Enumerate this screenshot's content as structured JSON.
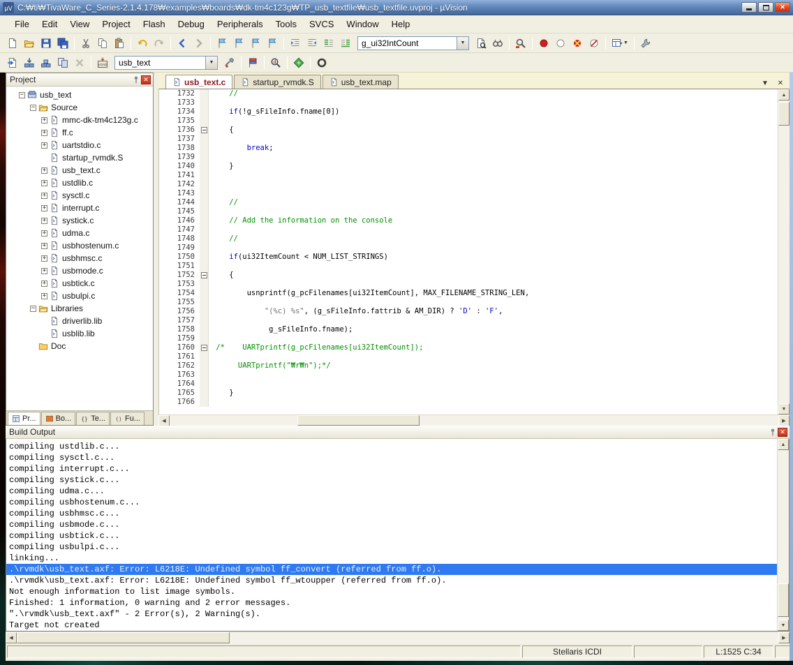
{
  "window": {
    "title": "C:₩ti₩TivaWare_C_Series-2.1.4.178₩examples₩boards₩dk-tm4c123g₩TP_usb_textfile₩usb_textfile.uvproj - µVision"
  },
  "menu": {
    "items": [
      "File",
      "Edit",
      "View",
      "Project",
      "Flash",
      "Debug",
      "Peripherals",
      "Tools",
      "SVCS",
      "Window",
      "Help"
    ]
  },
  "toolbar1": {
    "groups_left": [
      [
        "new-file",
        "open-file",
        "save",
        "save-all"
      ],
      [
        "cut",
        "copy",
        "paste"
      ],
      [
        "undo",
        "redo"
      ],
      [
        "nav-back",
        "nav-forward"
      ],
      [
        "bookmark-toggle",
        "bookmark-prev",
        "bookmark-next",
        "bookmark-clear-all"
      ],
      [
        "indent-right",
        "indent-left",
        "comment-selection",
        "uncomment-selection"
      ]
    ],
    "search_value": "g_ui32IntCount",
    "groups_right": [
      [
        "find-in-files",
        "find-in-files-next"
      ],
      [
        "find"
      ],
      [
        "breakpoint-toggle",
        "breakpoint-disable",
        "breakpoint-kill-all",
        "breakpoint-disable-all"
      ],
      [
        "window-layout"
      ],
      [
        "configure"
      ]
    ]
  },
  "toolbar2": {
    "groups_left": [
      [
        "translate-file",
        "build-target",
        "rebuild-all",
        "batch-build",
        "stop-build"
      ],
      [
        "download-flash"
      ]
    ],
    "target_value": "usb_text",
    "groups_right": [
      [
        "options-for-target"
      ],
      [
        "file-extensions"
      ],
      [
        "debug-session"
      ],
      [
        "rte-manage"
      ],
      [
        "pack-installer"
      ]
    ]
  },
  "project_panel": {
    "title": "Project",
    "tree": [
      {
        "label": "usb_text",
        "level": 0,
        "icon": "target",
        "expander": "minus"
      },
      {
        "label": "Source",
        "level": 1,
        "icon": "folder-open",
        "expander": "minus"
      },
      {
        "label": "mmc-dk-tm4c123g.c",
        "level": 2,
        "icon": "file",
        "expander": "plus"
      },
      {
        "label": "ff.c",
        "level": 2,
        "icon": "file",
        "expander": "plus"
      },
      {
        "label": "uartstdio.c",
        "level": 2,
        "icon": "file",
        "expander": "plus"
      },
      {
        "label": "startup_rvmdk.S",
        "level": 2,
        "icon": "file",
        "expander": "none"
      },
      {
        "label": "usb_text.c",
        "level": 2,
        "icon": "file",
        "expander": "plus"
      },
      {
        "label": "ustdlib.c",
        "level": 2,
        "icon": "file",
        "expander": "plus"
      },
      {
        "label": "sysctl.c",
        "level": 2,
        "icon": "file",
        "expander": "plus"
      },
      {
        "label": "interrupt.c",
        "level": 2,
        "icon": "file",
        "expander": "plus"
      },
      {
        "label": "systick.c",
        "level": 2,
        "icon": "file",
        "expander": "plus"
      },
      {
        "label": "udma.c",
        "level": 2,
        "icon": "file",
        "expander": "plus"
      },
      {
        "label": "usbhostenum.c",
        "level": 2,
        "icon": "file",
        "expander": "plus"
      },
      {
        "label": "usbhmsc.c",
        "level": 2,
        "icon": "file",
        "expander": "plus"
      },
      {
        "label": "usbmode.c",
        "level": 2,
        "icon": "file",
        "expander": "plus"
      },
      {
        "label": "usbtick.c",
        "level": 2,
        "icon": "file",
        "expander": "plus"
      },
      {
        "label": "usbulpi.c",
        "level": 2,
        "icon": "file",
        "expander": "plus"
      },
      {
        "label": "Libraries",
        "level": 1,
        "icon": "folder-open",
        "expander": "minus"
      },
      {
        "label": "driverlib.lib",
        "level": 2,
        "icon": "file",
        "expander": "none"
      },
      {
        "label": "usblib.lib",
        "level": 2,
        "icon": "file",
        "expander": "none"
      },
      {
        "label": "Doc",
        "level": 1,
        "icon": "folder",
        "expander": "none"
      }
    ],
    "tabs": [
      {
        "label": "Pr...",
        "icon": "project-tab"
      },
      {
        "label": "Bo...",
        "icon": "books-tab"
      },
      {
        "label": "Te...",
        "icon": "templates-tab"
      },
      {
        "label": "Fu...",
        "icon": "functions-tab"
      }
    ]
  },
  "editor": {
    "tabs": [
      {
        "label": "usb_text.c",
        "active": true
      },
      {
        "label": "startup_rvmdk.S",
        "active": false
      },
      {
        "label": "usb_text.map",
        "active": false
      }
    ],
    "lines": [
      {
        "n": 1732,
        "f": false,
        "s": [
          [
            "    //",
            "com"
          ]
        ]
      },
      {
        "n": 1733,
        "f": false,
        "s": []
      },
      {
        "n": 1734,
        "f": false,
        "s": [
          [
            "    ",
            "pln"
          ],
          [
            "if",
            "kw"
          ],
          [
            "(!g_sFileInfo.fname[0])",
            "pln"
          ]
        ]
      },
      {
        "n": 1735,
        "f": false,
        "s": []
      },
      {
        "n": 1736,
        "f": true,
        "s": [
          [
            "    {",
            "pln"
          ]
        ]
      },
      {
        "n": 1737,
        "f": false,
        "s": []
      },
      {
        "n": 1738,
        "f": false,
        "s": [
          [
            "        ",
            "pln"
          ],
          [
            "break",
            "kw"
          ],
          [
            ";",
            "pln"
          ]
        ]
      },
      {
        "n": 1739,
        "f": false,
        "s": []
      },
      {
        "n": 1740,
        "f": false,
        "s": [
          [
            "    }",
            "pln"
          ]
        ]
      },
      {
        "n": 1741,
        "f": false,
        "s": []
      },
      {
        "n": 1742,
        "f": false,
        "s": []
      },
      {
        "n": 1743,
        "f": false,
        "s": []
      },
      {
        "n": 1744,
        "f": false,
        "s": [
          [
            "    //",
            "com"
          ]
        ]
      },
      {
        "n": 1745,
        "f": false,
        "s": []
      },
      {
        "n": 1746,
        "f": false,
        "s": [
          [
            "    // Add the information on the console",
            "com"
          ]
        ]
      },
      {
        "n": 1747,
        "f": false,
        "s": []
      },
      {
        "n": 1748,
        "f": false,
        "s": [
          [
            "    //",
            "com"
          ]
        ]
      },
      {
        "n": 1749,
        "f": false,
        "s": []
      },
      {
        "n": 1750,
        "f": false,
        "s": [
          [
            "    ",
            "pln"
          ],
          [
            "if",
            "kw"
          ],
          [
            "(ui32ItemCount < NUM_LIST_STRINGS)",
            "pln"
          ]
        ]
      },
      {
        "n": 1751,
        "f": false,
        "s": []
      },
      {
        "n": 1752,
        "f": true,
        "s": [
          [
            "    {",
            "pln"
          ]
        ]
      },
      {
        "n": 1753,
        "f": false,
        "s": []
      },
      {
        "n": 1754,
        "f": false,
        "s": [
          [
            "        usnprintf(g_pcFilenames[ui32ItemCount], MAX_FILENAME_STRING_LEN,",
            "pln"
          ]
        ]
      },
      {
        "n": 1755,
        "f": false,
        "s": []
      },
      {
        "n": 1756,
        "f": false,
        "s": [
          [
            "            ",
            "pln"
          ],
          [
            "\"(%c) %s\"",
            "str"
          ],
          [
            ", (g_sFileInfo.fattrib & AM_DIR) ? ",
            "pln"
          ],
          [
            "'D'",
            "chr"
          ],
          [
            " : ",
            "pln"
          ],
          [
            "'F'",
            "chr"
          ],
          [
            ",",
            "pln"
          ]
        ]
      },
      {
        "n": 1757,
        "f": false,
        "s": []
      },
      {
        "n": 1758,
        "f": false,
        "s": [
          [
            "             g_sFileInfo.fname);",
            "pln"
          ]
        ]
      },
      {
        "n": 1759,
        "f": false,
        "s": []
      },
      {
        "n": 1760,
        "f": true,
        "s": [
          [
            " /*    UARTprintf(g_pcFilenames[ui32ItemCount]);",
            "com"
          ]
        ]
      },
      {
        "n": 1761,
        "f": false,
        "s": []
      },
      {
        "n": 1762,
        "f": false,
        "s": [
          [
            "      UARTprintf(\"₩r₩n\");*/",
            "com"
          ]
        ]
      },
      {
        "n": 1763,
        "f": false,
        "s": []
      },
      {
        "n": 1764,
        "f": false,
        "s": []
      },
      {
        "n": 1765,
        "f": false,
        "s": [
          [
            "    }",
            "pln"
          ]
        ]
      },
      {
        "n": 1766,
        "f": false,
        "s": []
      }
    ]
  },
  "build_output": {
    "title": "Build Output",
    "lines": [
      {
        "text": "compiling ustdlib.c...",
        "highlight": false
      },
      {
        "text": "compiling sysctl.c...",
        "highlight": false
      },
      {
        "text": "compiling interrupt.c...",
        "highlight": false
      },
      {
        "text": "compiling systick.c...",
        "highlight": false
      },
      {
        "text": "compiling udma.c...",
        "highlight": false
      },
      {
        "text": "compiling usbhostenum.c...",
        "highlight": false
      },
      {
        "text": "compiling usbhmsc.c...",
        "highlight": false
      },
      {
        "text": "compiling usbmode.c...",
        "highlight": false
      },
      {
        "text": "compiling usbtick.c...",
        "highlight": false
      },
      {
        "text": "compiling usbulpi.c...",
        "highlight": false
      },
      {
        "text": "linking...",
        "highlight": false
      },
      {
        "text": ".\\rvmdk\\usb_text.axf: Error: L6218E: Undefined symbol ff_convert (referred from ff.o).",
        "highlight": true
      },
      {
        "text": ".\\rvmdk\\usb_text.axf: Error: L6218E: Undefined symbol ff_wtoupper (referred from ff.o).",
        "highlight": false
      },
      {
        "text": "Not enough information to list image symbols.",
        "highlight": false
      },
      {
        "text": "Finished: 1 information, 0 warning and 2 error messages.",
        "highlight": false
      },
      {
        "text": "\".\\rvmdk\\usb_text.axf\" - 2 Error(s), 2 Warning(s).",
        "highlight": false
      },
      {
        "text": "Target not created",
        "highlight": false
      }
    ]
  },
  "statusbar": {
    "device": "Stellaris ICDI",
    "cursor": "L:1525 C:34"
  },
  "colors": {
    "titlebar_blue": "#6189bc",
    "error_row_bg": "#2f7af0",
    "comment_green": "#009000",
    "keyword_blue": "#0000cd",
    "active_tab_text": "#8b1a1a"
  }
}
